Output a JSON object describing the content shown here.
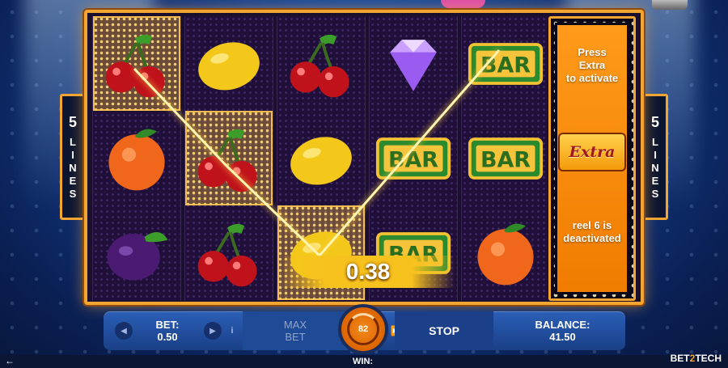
{
  "game": {
    "lines_left": {
      "number": "5",
      "word": "LINES"
    },
    "lines_right": {
      "number": "5",
      "word": "LINES"
    },
    "win_amount": "0.38"
  },
  "reels": [
    {
      "symbols": [
        "cherry",
        "orange",
        "plum"
      ],
      "winning": [
        true,
        false,
        false
      ]
    },
    {
      "symbols": [
        "lemon",
        "cherry",
        "cherry"
      ],
      "winning": [
        false,
        true,
        false
      ]
    },
    {
      "symbols": [
        "cherry",
        "lemon",
        "lemon"
      ],
      "winning": [
        false,
        false,
        true
      ]
    },
    {
      "symbols": [
        "diamond",
        "bar",
        "bar"
      ],
      "winning": [
        false,
        false,
        false
      ]
    },
    {
      "symbols": [
        "bar",
        "bar",
        "orange"
      ],
      "winning": [
        false,
        false,
        false
      ]
    }
  ],
  "extra_panel": {
    "top_text_1": "Press",
    "top_text_2": "Extra",
    "top_text_3": "to activate",
    "button_label": "Extra",
    "bottom_text_1": "reel 6 is",
    "bottom_text_2": "deactivated"
  },
  "controls": {
    "bet_label": "BET:",
    "bet_value": "0.50",
    "max_bet_line1": "MAX",
    "max_bet_line2": "BET",
    "spin_count": "82",
    "stop_label": "STOP",
    "balance_label": "BALANCE:",
    "balance_value": "41.50"
  },
  "footer": {
    "win_label": "WIN:",
    "brand_part1": "BET",
    "brand_part2": "2",
    "brand_part3": "TECH"
  },
  "colors": {
    "frame": "#f2a531",
    "panel_orange": "#f07c00",
    "bar_blue": "#2b5fb7"
  }
}
